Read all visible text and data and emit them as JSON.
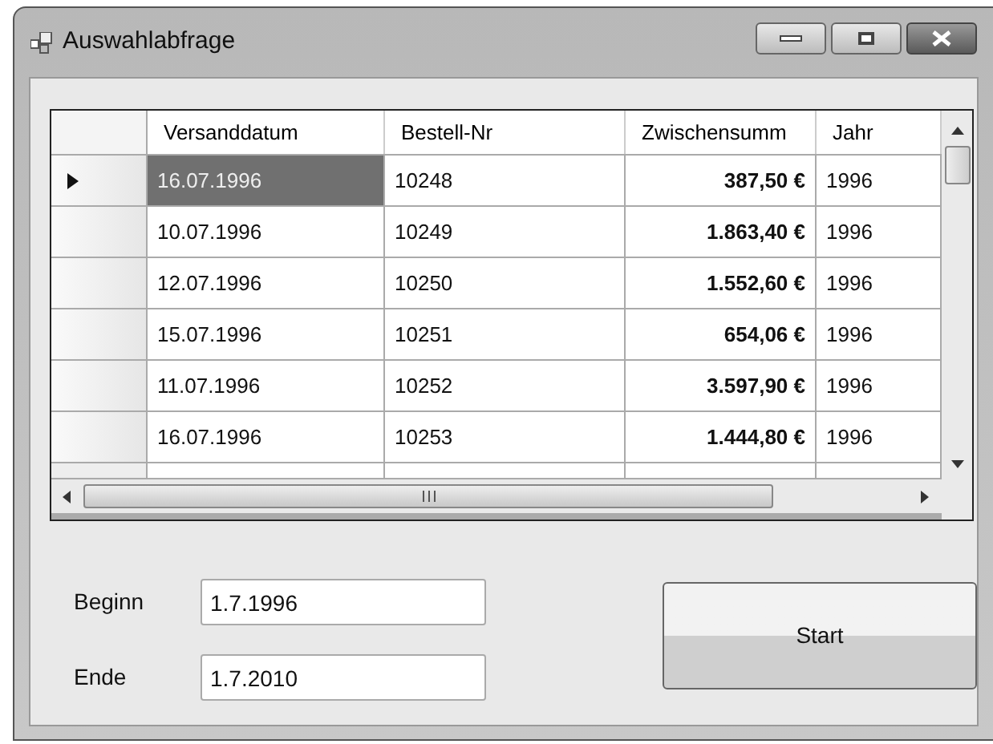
{
  "window": {
    "title": "Auswahlabfrage"
  },
  "table": {
    "columns": [
      "Versanddatum",
      "Bestell-Nr",
      "Zwischensumm",
      "Jahr"
    ],
    "rows": [
      {
        "selected": true,
        "cells": [
          "16.07.1996",
          "10248",
          "387,50 €",
          "1996"
        ]
      },
      {
        "selected": false,
        "cells": [
          "10.07.1996",
          "10249",
          "1.863,40 €",
          "1996"
        ]
      },
      {
        "selected": false,
        "cells": [
          "12.07.1996",
          "10250",
          "1.552,60 €",
          "1996"
        ]
      },
      {
        "selected": false,
        "cells": [
          "15.07.1996",
          "10251",
          "654,06 €",
          "1996"
        ]
      },
      {
        "selected": false,
        "cells": [
          "11.07.1996",
          "10252",
          "3.597,90 €",
          "1996"
        ]
      },
      {
        "selected": false,
        "cells": [
          "16.07.1996",
          "10253",
          "1.444,80 €",
          "1996"
        ]
      }
    ]
  },
  "fields": [
    {
      "label": "Beginn",
      "value": "1.7.1996"
    },
    {
      "label": "Ende",
      "value": "1.7.2010"
    }
  ],
  "buttons": [
    "Start"
  ]
}
